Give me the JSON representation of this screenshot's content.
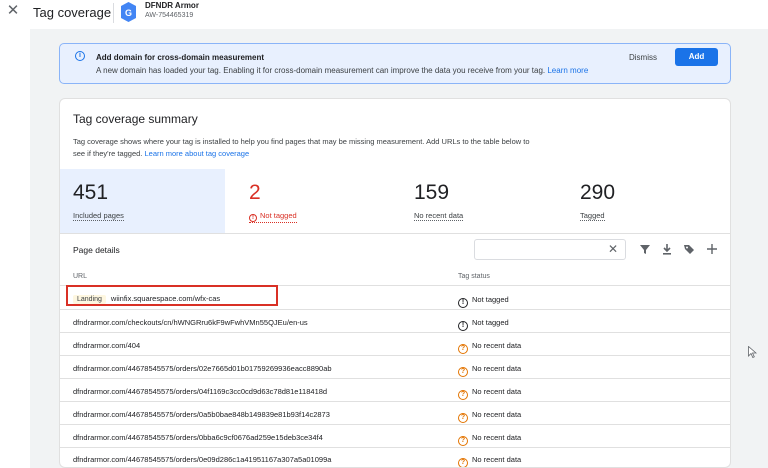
{
  "header": {
    "title": "Tag coverage",
    "account_name": "DFNDR Armor",
    "account_id": "AW-754465319"
  },
  "banner": {
    "title": "Add domain for cross-domain measurement",
    "text": "A new domain has loaded your tag. Enabling it for cross-domain measurement can improve the data you receive from your tag.",
    "link": "Learn more",
    "dismiss": "Dismiss",
    "add": "Add"
  },
  "summary": {
    "title": "Tag coverage summary",
    "desc_line1": "Tag coverage shows where your tag is installed to help you find pages that may be missing measurement. Add URLs to the table below to",
    "desc_line2": "see if they're tagged.",
    "desc_link": "Learn more about tag coverage",
    "metrics": [
      {
        "value": "451",
        "label": "Included pages"
      },
      {
        "value": "2",
        "label": "Not tagged"
      },
      {
        "value": "159",
        "label": "No recent data"
      },
      {
        "value": "290",
        "label": "Tagged"
      }
    ]
  },
  "table": {
    "title": "Page details",
    "col_url": "URL",
    "col_status": "Tag status",
    "landing_badge": "Landing",
    "rows": [
      {
        "url": "wiinfix.squarespace.com/wfx-cas",
        "status": "Not tagged"
      },
      {
        "url": "dfndrarmor.com/checkouts/cn/hWNGRru6kF9wFwhVMn55QJEu/en-us",
        "status": "Not tagged"
      },
      {
        "url": "dfndrarmor.com/404",
        "status": "No recent data"
      },
      {
        "url": "dfndrarmor.com/44678545575/orders/02e7665d01b01759269936eacc8890ab",
        "status": "No recent data"
      },
      {
        "url": "dfndrarmor.com/44678545575/orders/04f1169c3cc0cd9d63c78d81e118418d",
        "status": "No recent data"
      },
      {
        "url": "dfndrarmor.com/44678545575/orders/0a5b0bae848b149839e81b93f14c2873",
        "status": "No recent data"
      },
      {
        "url": "dfndrarmor.com/44678545575/orders/0bba6c9cf0676ad259e15deb3ce34f4",
        "status": "No recent data"
      },
      {
        "url": "dfndrarmor.com/44678545575/orders/0e09d286c1a41951167a307a5a01099a",
        "status": "No recent data"
      }
    ]
  },
  "colors": {
    "accent": "#1a73e8",
    "error": "#d93025",
    "warning": "#e37400",
    "selected_bg": "#e8f0fe"
  },
  "icons": {
    "close": "close-icon",
    "info": "info-icon",
    "filter": "filter-icon",
    "download": "download-icon",
    "tag": "tag-icon",
    "add": "plus-icon",
    "not_tagged": "alert-circle-icon",
    "no_recent": "help-circle-icon"
  }
}
